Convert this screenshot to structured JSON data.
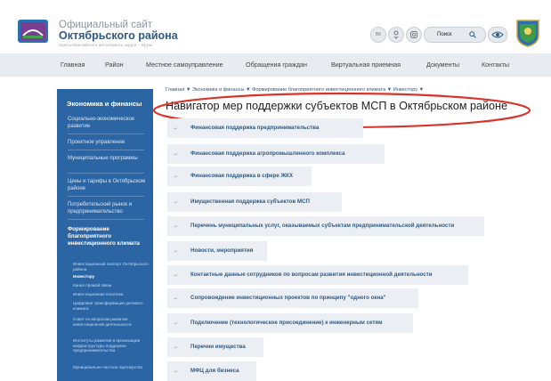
{
  "header": {
    "title_line1": "Официальный сайт",
    "title_line2": "Октябрьского района",
    "subtitle": "Ханты-Мансийского автономного округа – Югры",
    "social": [
      "ВК",
      "",
      ""
    ],
    "search_label": "Поиск",
    "accent_color": "#2f5a84"
  },
  "nav": {
    "items": [
      "Главная",
      "Район",
      "Местное самоуправление",
      "Обращения граждан",
      "Виртуальная приемная",
      "Документы",
      "Контакты"
    ]
  },
  "sidebar": {
    "heading": "Экономика и финансы",
    "items": [
      "Социально-экономическое развитие",
      "Проектное управление",
      "Муниципальные программы",
      "Цены и тарифы в Октябрьском районе",
      "Потребительский рынок и предпринимательство"
    ],
    "section_title": "Формирование благоприятного инвестиционного климата",
    "subitems": [
      "Инвестиционный паспорт Октябрьского района",
      "Инвестору",
      "Канал прямой связи",
      "Инвестиционная политика",
      "Цифровая трансформация делового климата",
      "Совет по вопросам развития инвестиционной деятельности",
      "Институты развития и организации инфраструктуры поддержки предпринимательства",
      "Муниципально-частное партнерство"
    ],
    "background": "#2b65a4"
  },
  "breadcrumb": "Главная ▼ Экономика и финансы ▼ Формирование благоприятного инвестиционного климата ▼ Инвестору ▼",
  "page_title": "Навигатор мер поддержки субъектов МСП в Октябрьском районе",
  "links": [
    "Финансовая поддержка предпринимательства",
    "Финансовая поддержка агропромышленного комплекса",
    "Финансовая поддержка в сфере ЖКХ",
    "Имущественная поддержка субъектов МСП",
    "Перечень муниципальных услуг, оказываемых субъектам предпринимательской деятельности",
    "Новости, мероприятия",
    "Контактные данные сотрудников по вопросам развития инвестиционной деятельности",
    "Сопровождение инвестиционных проектов по принципу \"одного окна\"",
    "Подключение (технологическое присоединение) к инженерным сетям",
    "Перечни имущества",
    "МФЦ для бизнеса"
  ],
  "link_arrow": "→"
}
